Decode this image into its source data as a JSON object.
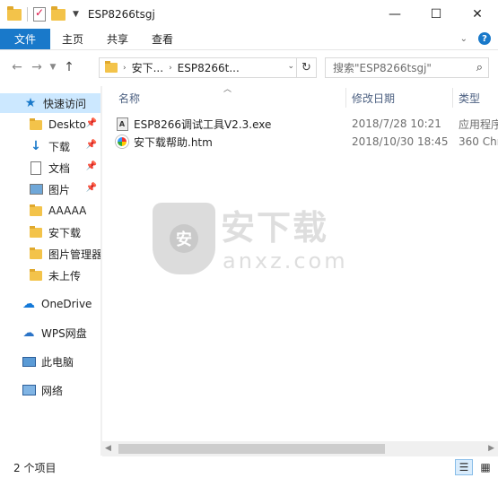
{
  "window": {
    "title": "ESP8266tsgj",
    "minimize": "—",
    "maximize": "☐",
    "close": "✕"
  },
  "ribbon": {
    "tabs": [
      "文件",
      "主页",
      "共享",
      "查看"
    ],
    "help": "?"
  },
  "address": {
    "crumbs": [
      "安下...",
      "ESP8266t..."
    ],
    "search_placeholder": "搜索\"ESP8266tsgj\""
  },
  "sidebar": {
    "items": [
      {
        "label": "快速访问",
        "icon": "star-icon",
        "selected": true
      },
      {
        "label": "Deskto",
        "icon": "folder-icon",
        "pinned": true
      },
      {
        "label": "下载",
        "icon": "download-icon",
        "pinned": true
      },
      {
        "label": "文档",
        "icon": "document-icon",
        "pinned": true
      },
      {
        "label": "图片",
        "icon": "picture-icon",
        "pinned": true
      },
      {
        "label": "AAAAA",
        "icon": "folder-icon"
      },
      {
        "label": "安下载",
        "icon": "folder-icon"
      },
      {
        "label": "图片管理器",
        "icon": "folder-icon"
      },
      {
        "label": "未上传",
        "icon": "folder-icon"
      },
      {
        "label": "OneDrive",
        "icon": "onedrive-icon"
      },
      {
        "label": "WPS网盘",
        "icon": "wps-cloud-icon"
      },
      {
        "label": "此电脑",
        "icon": "computer-icon"
      },
      {
        "label": "网络",
        "icon": "network-icon"
      }
    ]
  },
  "columns": {
    "name": "名称",
    "date": "修改日期",
    "type": "类型"
  },
  "files": [
    {
      "name": "ESP8266调试工具V2.3.exe",
      "date": "2018/7/28 10:21",
      "type": "应用程序",
      "icon": "exe-icon"
    },
    {
      "name": "安下载帮助.htm",
      "date": "2018/10/30 18:45",
      "type": "360 Chr",
      "icon": "htm-icon"
    }
  ],
  "watermark": {
    "cn": "安下载",
    "en": "anxz.com"
  },
  "status": {
    "count": "2 个项目"
  }
}
